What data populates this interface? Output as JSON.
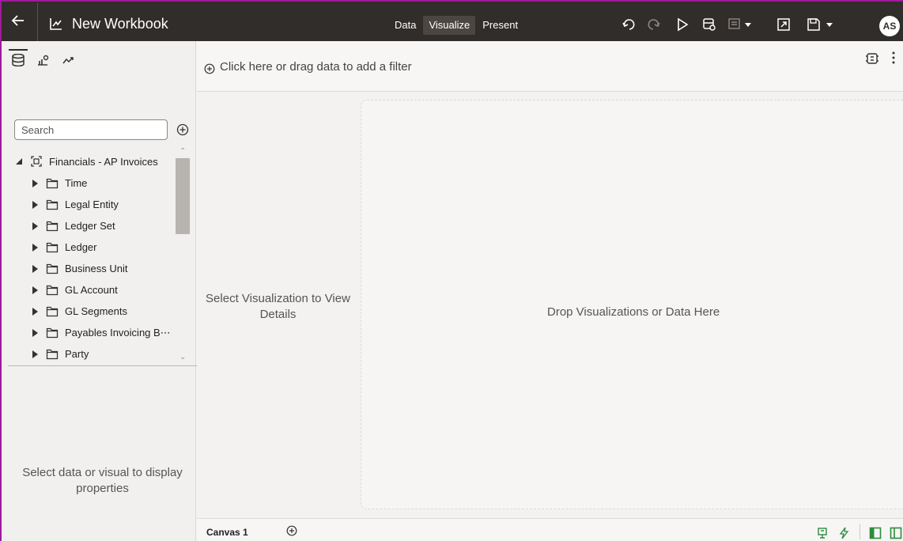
{
  "header": {
    "title": "New Workbook",
    "modes": [
      {
        "label": "Data",
        "active": false
      },
      {
        "label": "Visualize",
        "active": true
      },
      {
        "label": "Present",
        "active": false
      }
    ],
    "avatar_initials": "AS"
  },
  "data_panel": {
    "search_placeholder": "Search",
    "root_label": "Financials - AP Invoices",
    "folders": [
      "Time",
      "Legal Entity",
      "Ledger Set",
      "Ledger",
      "Business Unit",
      "GL Account",
      "GL Segments",
      "Payables Invoicing B⋯",
      "Party"
    ],
    "properties_message": "Select data or visual to display properties"
  },
  "filter_bar": {
    "hint": "Click here or drag data to add a filter"
  },
  "grammar": {
    "message": "Select Visualization to View Details"
  },
  "canvas": {
    "drop_message": "Drop Visualizations or Data Here"
  },
  "canvas_tabs": {
    "active_label": "Canvas 1"
  },
  "colors": {
    "topbar": "#312d2a",
    "frame": "#a0199a",
    "panel": "#f1f0ee",
    "accent_green": "#2e8b3e"
  }
}
